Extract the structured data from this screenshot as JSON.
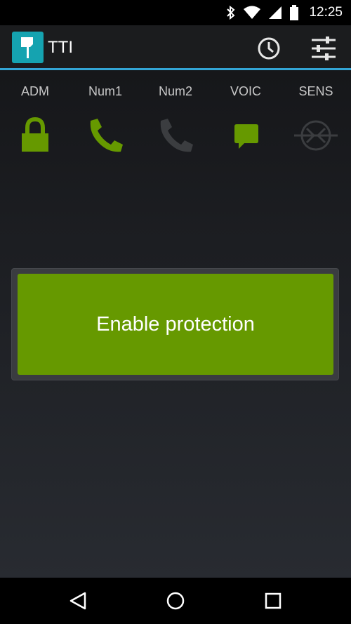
{
  "status_bar": {
    "time": "12:25",
    "icons": [
      "bluetooth-icon",
      "wifi-icon",
      "cell-signal-icon",
      "battery-icon"
    ]
  },
  "app_bar": {
    "title": "TTI",
    "actions": [
      "history-icon",
      "settings-sliders-icon"
    ]
  },
  "colors": {
    "accent": "#33a5d6",
    "active_green": "#669900",
    "inactive_gray": "#3b3d40",
    "logo_teal": "#15a3b0"
  },
  "status_items": [
    {
      "label": "ADM",
      "icon": "lock-icon",
      "state": "active"
    },
    {
      "label": "Num1",
      "icon": "phone-icon",
      "state": "active"
    },
    {
      "label": "Num2",
      "icon": "phone-icon",
      "state": "inactive"
    },
    {
      "label": "VOIC",
      "icon": "message-icon",
      "state": "active"
    },
    {
      "label": "SENS",
      "icon": "sensor-icon",
      "state": "inactive"
    }
  ],
  "main": {
    "enable_button_label": "Enable protection"
  },
  "nav_bar": {
    "buttons": [
      "back-icon",
      "home-icon",
      "recents-icon"
    ]
  }
}
